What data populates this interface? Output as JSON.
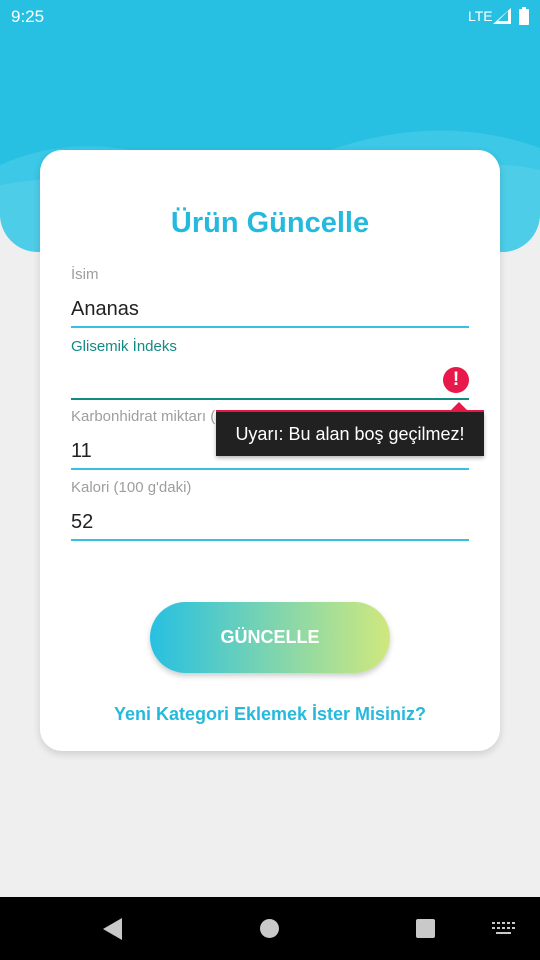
{
  "status_bar": {
    "time": "9:25",
    "network": "LTE"
  },
  "form": {
    "title": "Ürün Güncelle",
    "fields": [
      {
        "label": "İsim",
        "value": "Ananas"
      },
      {
        "label": "Glisemik İndeks",
        "value": ""
      },
      {
        "label": "Karbonhidrat miktarı (100 g'daki)",
        "value": "11"
      },
      {
        "label": "Kalori (100 g'daki)",
        "value": "52"
      }
    ],
    "error_tooltip": "Uyarı: Bu alan boş geçilmez!",
    "error_icon_glyph": "!",
    "update_button": "GÜNCELLE",
    "new_category_link": "Yeni Kategori Eklemek İster Misiniz?"
  },
  "colors": {
    "primary": "#27c0e2",
    "focused": "#138a84",
    "error": "#e8194a",
    "gradient_end": "#d0e87e"
  }
}
